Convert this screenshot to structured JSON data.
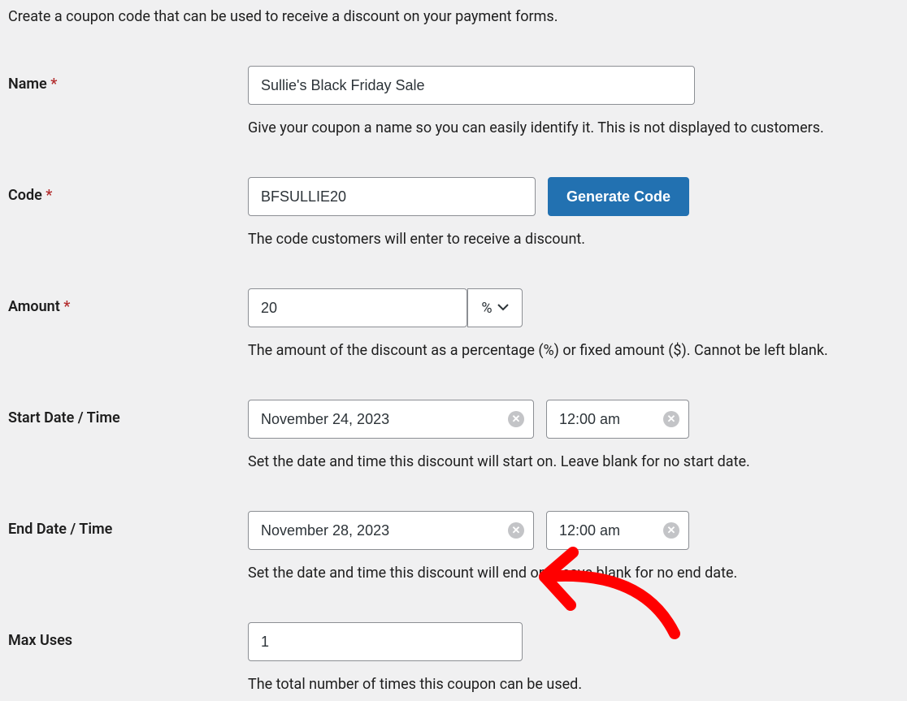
{
  "intro": "Create a coupon code that can be used to receive a discount on your payment forms.",
  "fields": {
    "name": {
      "label": "Name",
      "required": "*",
      "value": "Sullie's Black Friday Sale",
      "help": "Give your coupon a name so you can easily identify it. This is not displayed to customers."
    },
    "code": {
      "label": "Code",
      "required": "*",
      "value": "BFSULLIE20",
      "button": "Generate Code",
      "help": "The code customers will enter to receive a discount."
    },
    "amount": {
      "label": "Amount",
      "required": "*",
      "value": "20",
      "unit": "%",
      "help": "The amount of the discount as a percentage (%) or fixed amount ($). Cannot be left blank."
    },
    "start": {
      "label": "Start Date / Time",
      "date": "November 24, 2023",
      "time": "12:00 am",
      "help": "Set the date and time this discount will start on. Leave blank for no start date."
    },
    "end": {
      "label": "End Date / Time",
      "date": "November 28, 2023",
      "time": "12:00 am",
      "help": "Set the date and time this discount will end on. Leave blank for no end date."
    },
    "maxuses": {
      "label": "Max Uses",
      "value": "1",
      "help": "The total number of times this coupon can be used."
    }
  }
}
